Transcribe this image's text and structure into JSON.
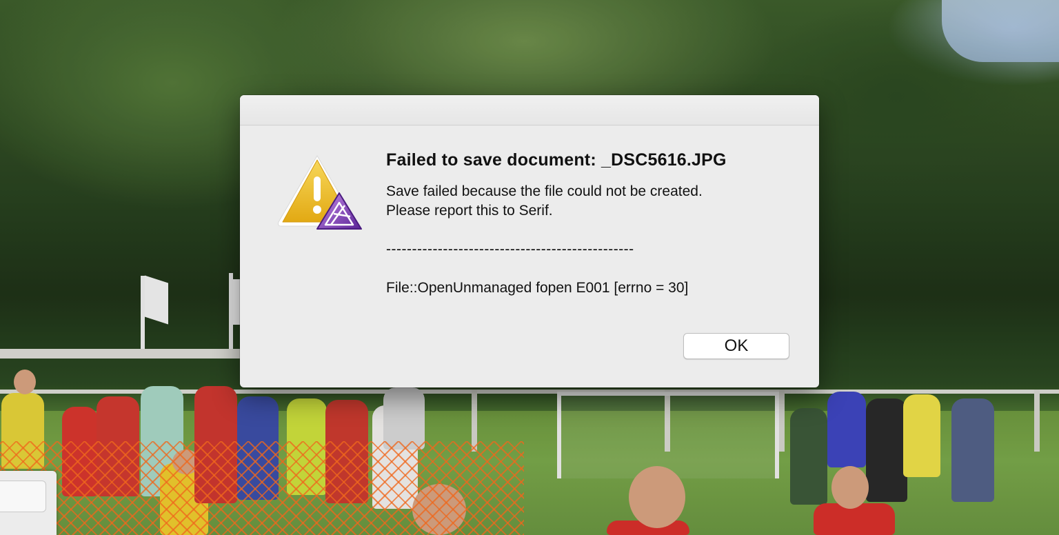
{
  "background": {
    "description_icon": "photo-background"
  },
  "dialog": {
    "title": "Failed to save document: _DSC5616.JPG",
    "message_line1": "Save failed because the file could not be created.",
    "message_line2": "Please report this to Serif.",
    "separator": "------------------------------------------------",
    "error_detail": "File::OpenUnmanaged fopen E001 [errno = 30]",
    "ok_label": "OK",
    "icon": "warning-triangle-icon",
    "app_badge_icon": "affinity-photo-icon"
  },
  "colors": {
    "dialog_bg": "#ececec",
    "warning_yellow": "#f2c330",
    "affinity_purple": "#7b3fb5"
  }
}
